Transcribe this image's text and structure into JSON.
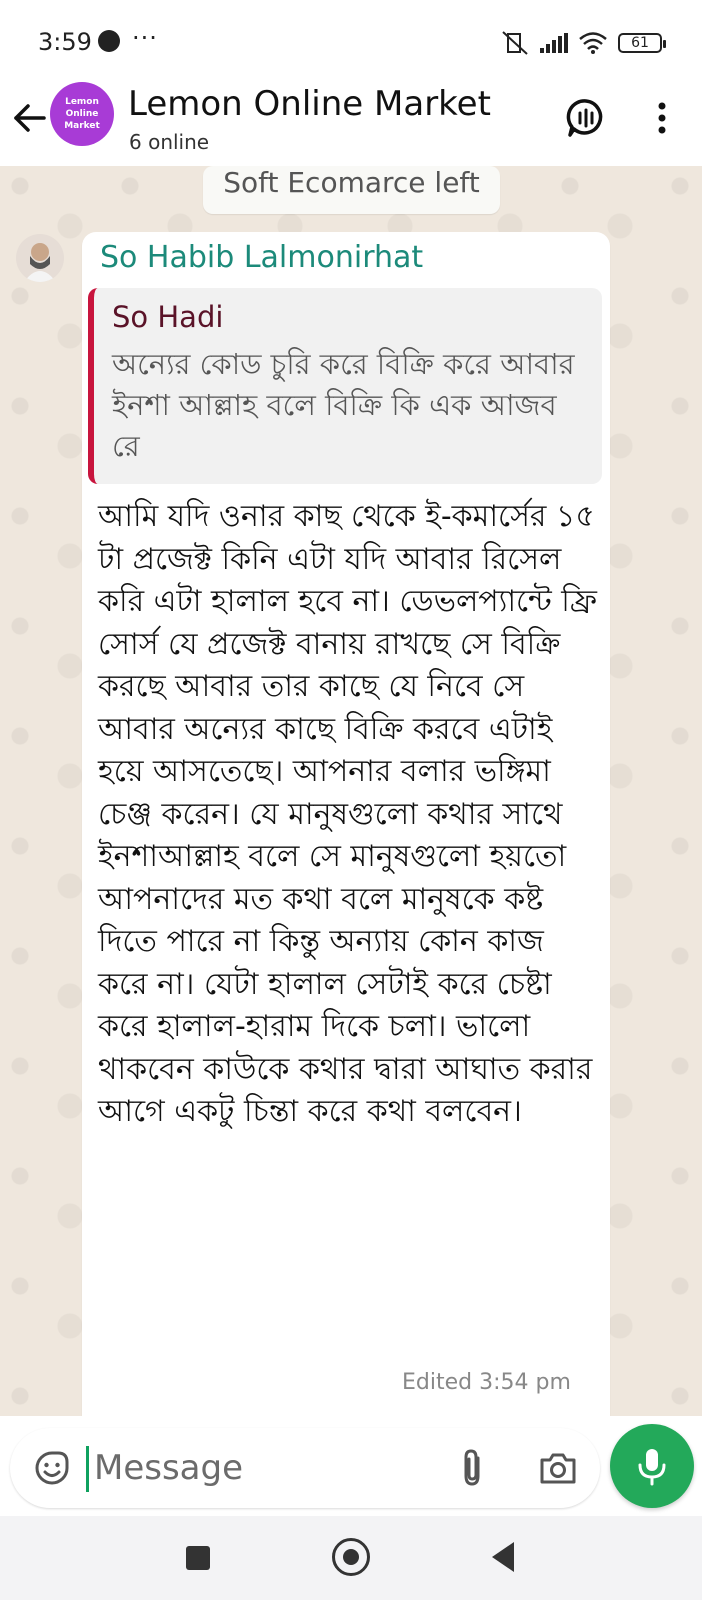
{
  "status_bar": {
    "time": "3:59",
    "more": "···",
    "battery_level": "61"
  },
  "header": {
    "avatar_lines": [
      "Lemon",
      "Online",
      "Market"
    ],
    "title": "Lemon Online Market",
    "subtitle": "6 online"
  },
  "chat": {
    "system_note": "Soft Ecomarce left",
    "message": {
      "sender_name": "So Habib Lalmonirhat",
      "quote": {
        "author": "So Hadi",
        "text": "অন্যের কোড চুরি করে বিক্রি করে আবার ইনশা আল্লাহ  বলে বিক্রি কি এক আজব রে"
      },
      "text": "আমি যদি ওনার কাছ থেকে ই-কমার্সের ১৫ টা প্রজেক্ট কিনি এটা যদি আবার রিসেল করি এটা হালাল হবে না। ডেভলপ্যান্টে ফ্রি সোর্স যে প্রজেক্ট বানায় রাখছে সে বিক্রি করছে আবার তার কাছে যে নিবে সে আবার অন্যের কাছে বিক্রি করবে এটাই হয়ে আসতেছে। আপনার বলার ভঙ্গিমা চেঞ্জ করেন। যে মানুষগুলো কথার সাথে ইনশাআল্লাহ বলে সে মানুষগুলো হয়তো আপনাদের মত কথা বলে মানুষকে কষ্ট দিতে পারে না কিন্তু অন্যায় কোন কাজ করে না। যেটা হালাল সেটাই করে চেষ্টা করে হালাল-হারাম দিকে চলা। ভালো থাকবেন কাউকে কথার দ্বারা আঘাত করার আগে একটু চিন্তা করে কথা বলবেন।",
      "timestamp": "Edited 3:54 pm"
    }
  },
  "input": {
    "placeholder": "Message"
  },
  "colors": {
    "accent_green": "#23a95a",
    "sender_name": "#1c8a7a",
    "quote_bar": "#c8143d",
    "avatar_purple": "#a83bd6"
  }
}
